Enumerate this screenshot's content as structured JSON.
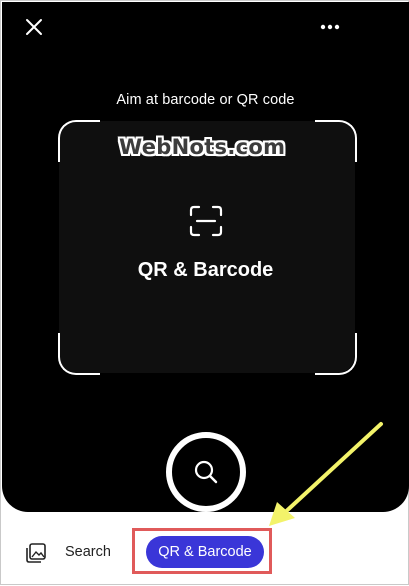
{
  "header": {
    "close_icon": "close-icon",
    "more_icon": "more-options-icon"
  },
  "scanner": {
    "hint": "Aim at barcode or QR code",
    "watermark": "WebNots.com",
    "mode_icon": "scan-frame-icon",
    "mode_title": "QR & Barcode"
  },
  "shutter": {
    "icon": "search-icon"
  },
  "bottom_bar": {
    "gallery_icon": "image-gallery-icon",
    "tabs": [
      {
        "label": "Search",
        "selected": false
      },
      {
        "label": "QR & Barcode",
        "selected": true
      }
    ]
  },
  "annotation": {
    "arrow_color": "#f3f36a",
    "highlight_color": "#e05a5a"
  },
  "colors": {
    "camera_bg": "#000000",
    "accent": "#3a36d8"
  }
}
